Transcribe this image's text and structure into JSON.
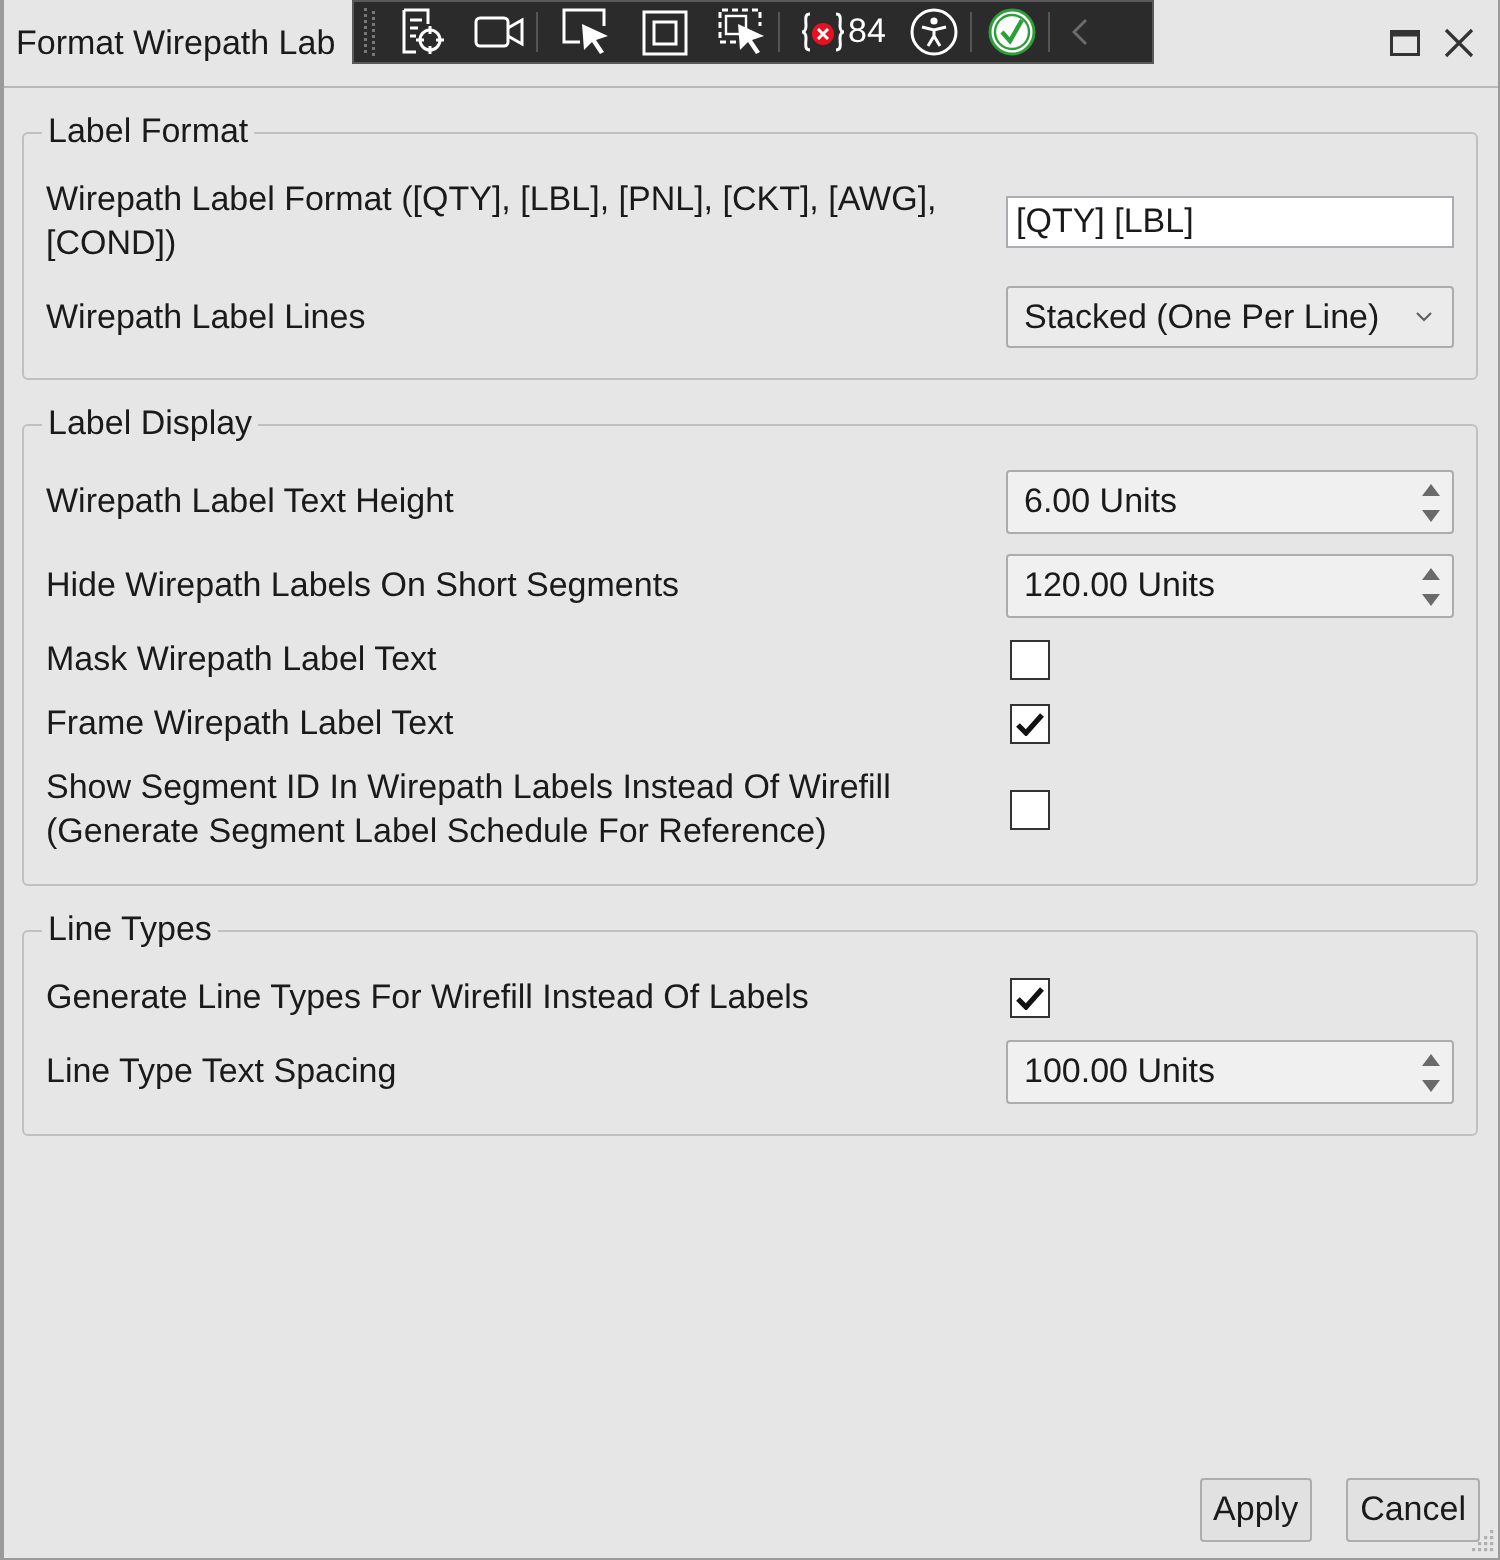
{
  "window": {
    "title": "Format Wirepath Lab"
  },
  "debug_toolbar": {
    "binding_errors": "84"
  },
  "groups": [
    {
      "title": "Label Format",
      "rows": [
        {
          "kind": "text",
          "label": "Wirepath Label Format ([QTY], [LBL], [PNL], [CKT], [AWG], [COND])",
          "value": "[QTY] [LBL]"
        },
        {
          "kind": "combo",
          "label": "Wirepath Label Lines",
          "value": "Stacked (One Per Line)"
        }
      ]
    },
    {
      "title": "Label Display",
      "rows": [
        {
          "kind": "spin",
          "label": "Wirepath Label Text Height",
          "value": "6.00 Units"
        },
        {
          "kind": "spin",
          "label": "Hide Wirepath Labels On Short Segments",
          "value": "120.00 Units"
        },
        {
          "kind": "checkbox",
          "label": "Mask Wirepath Label Text",
          "checked": false
        },
        {
          "kind": "checkbox",
          "label": "Frame Wirepath Label Text",
          "checked": true
        },
        {
          "kind": "checkbox",
          "label": "Show Segment ID In Wirepath Labels Instead Of Wirefill (Generate Segment Label Schedule For Reference)",
          "checked": false
        }
      ]
    },
    {
      "title": "Line Types",
      "rows": [
        {
          "kind": "checkbox",
          "label": "Generate Line Types For Wirefill Instead Of Labels",
          "checked": true
        },
        {
          "kind": "spin",
          "label": "Line Type Text Spacing",
          "value": "100.00 Units"
        }
      ]
    }
  ],
  "buttons": [
    "Apply",
    "Cancel"
  ]
}
